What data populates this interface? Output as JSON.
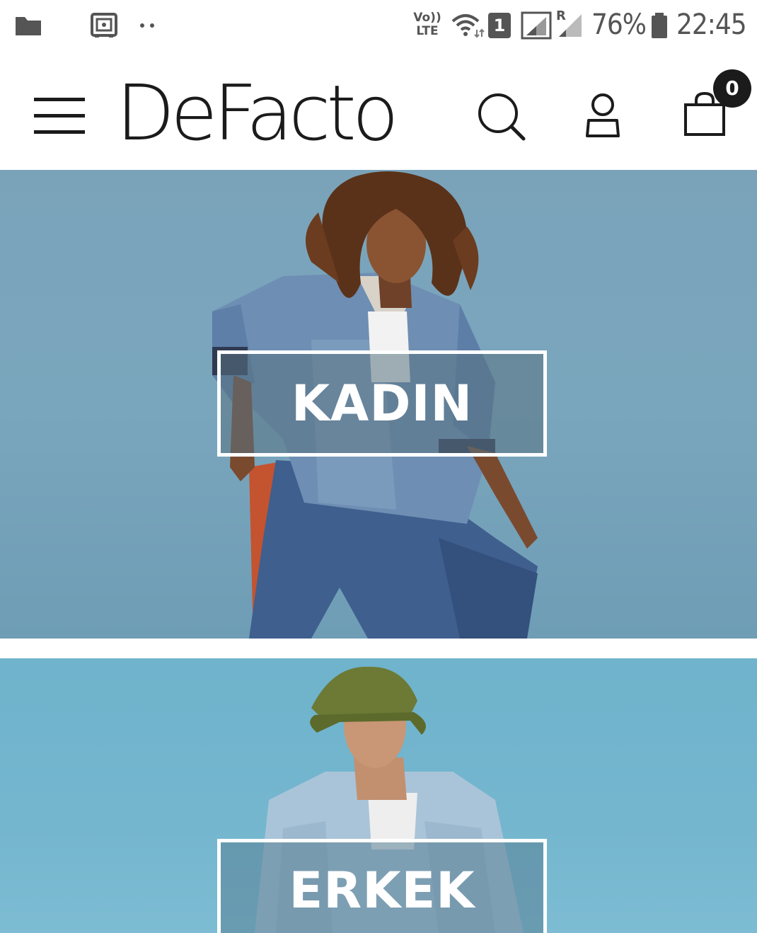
{
  "status_bar": {
    "left_icons": [
      "folder-icon",
      "safe-icon",
      "more-dots-icon"
    ],
    "volte_line1": "Vo))",
    "volte_line2": "LTE",
    "sim_badge": "1",
    "roaming": "R",
    "battery_percent": "76%",
    "time": "22:45"
  },
  "header": {
    "logo": "DeFacto",
    "icons": [
      "menu-icon",
      "search-icon",
      "user-icon",
      "shopping-bag-icon"
    ],
    "cart_count": "0"
  },
  "categories": [
    {
      "label": "KADIN"
    },
    {
      "label": "ERKEK"
    }
  ],
  "colors": {
    "header_bg": "#ffffff",
    "ink": "#1b1b1b",
    "kadin_banner_bg": "#7aa3ba",
    "erkek_banner_bg": "#72b4cd",
    "label_box_border": "#ffffff"
  }
}
